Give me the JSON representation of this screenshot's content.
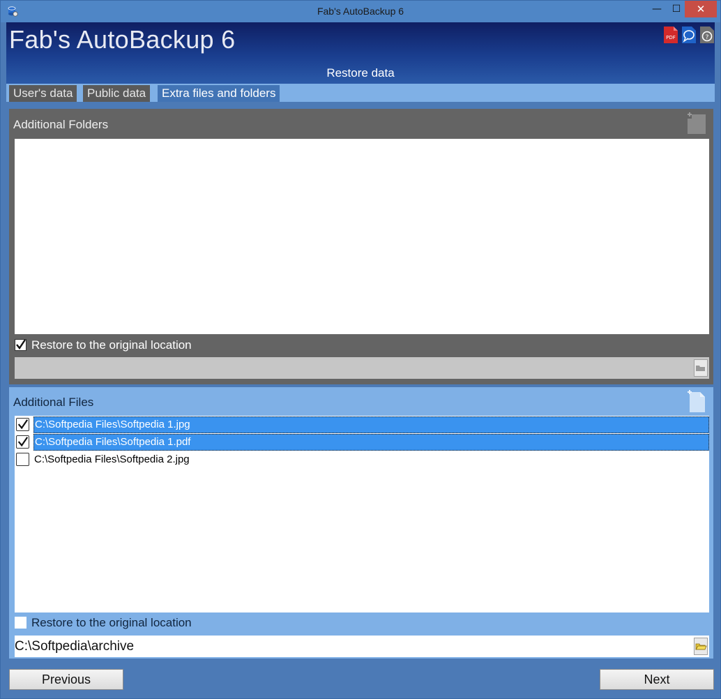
{
  "window": {
    "title": "Fab's AutoBackup 6",
    "minimize": "—",
    "maximize": "☐",
    "close": "✕"
  },
  "header": {
    "app_title": "Fab's AutoBackup 6",
    "subtitle": "Restore data",
    "icons": [
      "pdf-icon",
      "chat-icon",
      "help-icon"
    ]
  },
  "tabs": [
    {
      "label": "User's data",
      "active": false
    },
    {
      "label": "Public data",
      "active": false
    },
    {
      "label": "Extra files and folders",
      "active": true
    }
  ],
  "folders": {
    "title": "Additional Folders",
    "items": [],
    "restore_label": "Restore to the original location",
    "restore_checked": true,
    "path": ""
  },
  "files": {
    "title": "Additional Files",
    "items": [
      {
        "path": "C:\\Softpedia Files\\Softpedia 1.jpg",
        "checked": true,
        "selected": true
      },
      {
        "path": "C:\\Softpedia Files\\Softpedia 1.pdf",
        "checked": true,
        "selected": true
      },
      {
        "path": "C:\\Softpedia Files\\Softpedia 2.jpg",
        "checked": false,
        "selected": false
      }
    ],
    "restore_label": "Restore to the original location",
    "restore_checked": false,
    "path": "C:\\Softpedia\\archive"
  },
  "buttons": {
    "previous": "Previous",
    "next": "Next"
  },
  "colors": {
    "header_dark": "#0f1f63",
    "tab_bar": "#7fb0e6",
    "selection": "#3a93ef",
    "panel_gray": "#646464"
  }
}
